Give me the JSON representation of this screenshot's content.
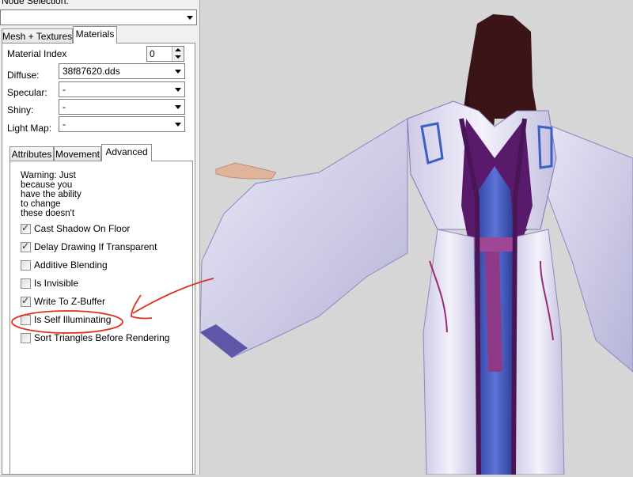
{
  "node_selection": {
    "label": "Node Selection:",
    "value": ""
  },
  "top_tabs": {
    "mesh_textures": "Mesh + Textures",
    "materials": "Materials"
  },
  "material": {
    "index_label": "Material Index",
    "index_value": "0",
    "diffuse_label": "Diffuse:",
    "diffuse_value": "38f87620.dds",
    "specular_label": "Specular:",
    "specular_value": "-",
    "shiny_label": "Shiny:",
    "shiny_value": "-",
    "lightmap_label": "Light Map:",
    "lightmap_value": "-"
  },
  "sub_tabs": {
    "attributes": "Attributes",
    "movement": "Movement",
    "advanced": "Advanced"
  },
  "warning_lines": [
    "Warning: Just",
    "because you",
    "have the ability",
    "to change",
    "these doesn't"
  ],
  "options": [
    {
      "label": "Cast Shadow On Floor",
      "checked": true
    },
    {
      "label": "Delay Drawing If Transparent",
      "checked": true
    },
    {
      "label": "Additive Blending",
      "checked": false
    },
    {
      "label": "Is Invisible",
      "checked": false
    },
    {
      "label": "Write To Z-Buffer",
      "checked": true
    },
    {
      "label": "Is Self Illuminating",
      "checked": false
    },
    {
      "label": "Sort Triangles Before Rendering",
      "checked": false
    }
  ],
  "check_glyph": "✓",
  "colors": {
    "annotation": "#e0301e",
    "panel_bg": "#f0f0f0",
    "viewport_bg": "#d6d6d6"
  }
}
